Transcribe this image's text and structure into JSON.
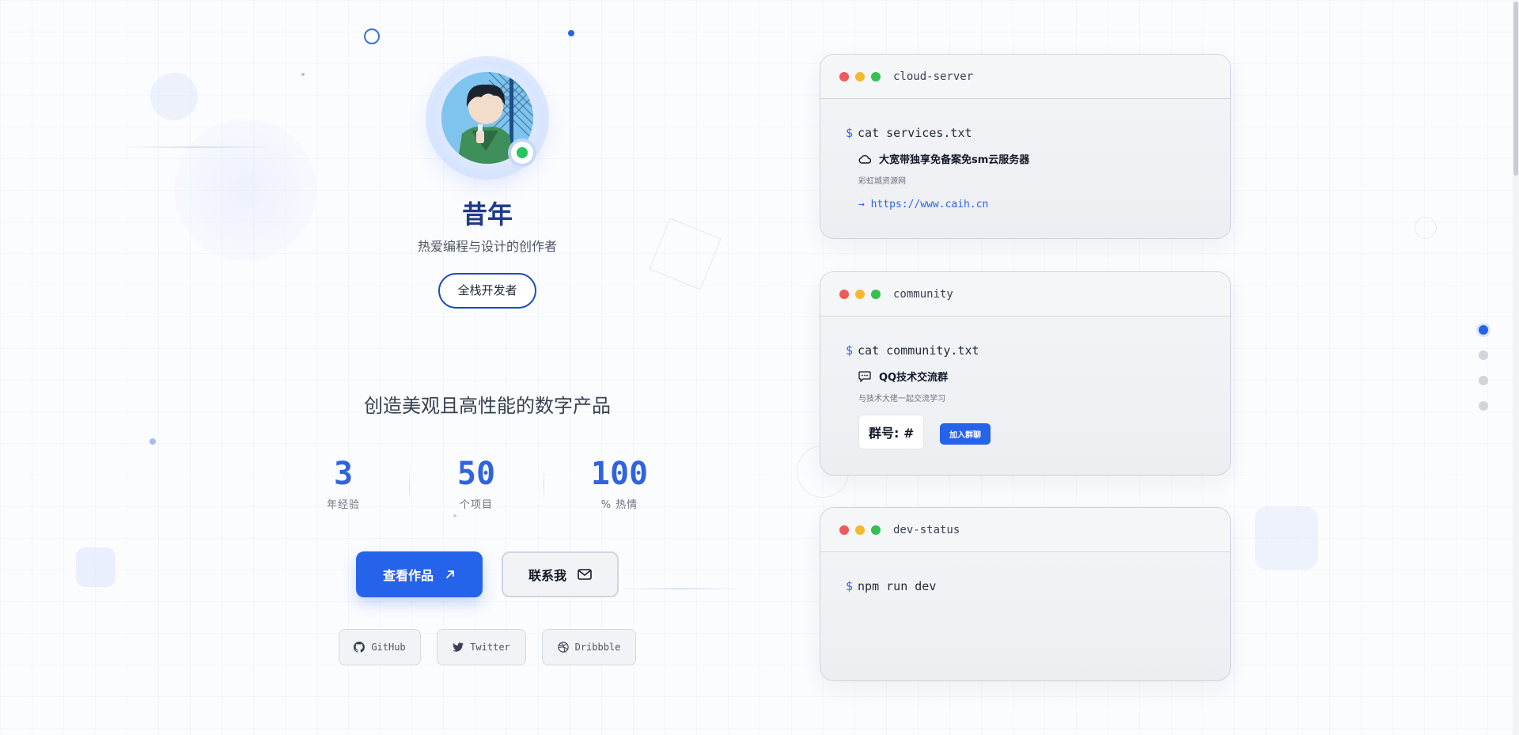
{
  "profile": {
    "name": "昔年",
    "tagline": "热爱编程与设计的创作者",
    "role": "全栈开发者"
  },
  "headline": "创造美观且高性能的数字产品",
  "stats": [
    {
      "value": "3",
      "label": "年经验"
    },
    {
      "value": "50",
      "label": "个项目"
    },
    {
      "value": "100",
      "label": "% 热情"
    }
  ],
  "actions": {
    "primary_label": "查看作品",
    "secondary_label": "联系我"
  },
  "social": [
    {
      "label": "GitHub",
      "icon": "github-icon"
    },
    {
      "label": "Twitter",
      "icon": "twitter-icon"
    },
    {
      "label": "Dribbble",
      "icon": "dribbble-icon"
    }
  ],
  "terminals": {
    "server": {
      "title": "cloud-server",
      "prompt": "$",
      "command": "cat services.txt",
      "item_title": "大宽带独享免备案免sm云服务器",
      "item_sub": "彩虹城资源网",
      "link_arrow": "→",
      "link": "https://www.caih.cn"
    },
    "community": {
      "title": "community",
      "prompt": "$",
      "command": "cat community.txt",
      "item_title": "QQ技术交流群",
      "item_sub": "与技术大佬一起交流学习",
      "group_label": "群号: #",
      "join_label": "加入群聊"
    },
    "devstatus": {
      "title": "dev-status",
      "prompt": "$",
      "command": "npm run dev"
    }
  },
  "colors": {
    "accent": "#2563eb",
    "name": "#1e3a8a",
    "online": "#22c55e"
  }
}
